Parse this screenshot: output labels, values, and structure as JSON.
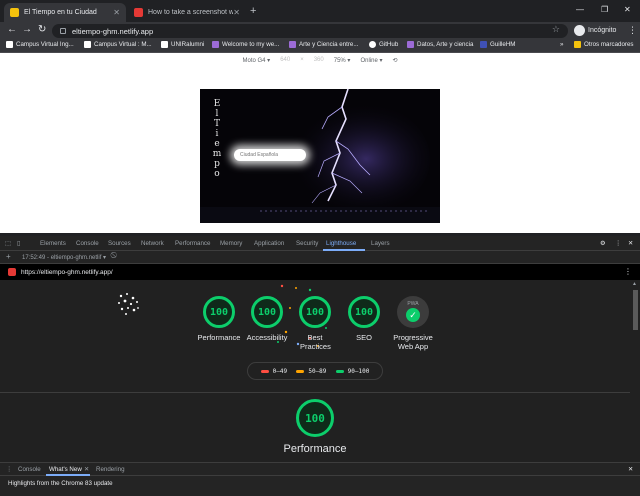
{
  "tabs": [
    {
      "title": "El Tiempo en tu Ciudad",
      "favicon_color": "#f4c20d",
      "active": true
    },
    {
      "title": "How to take a screenshot with h",
      "favicon_color": "#e53935",
      "active": false
    }
  ],
  "toolbar": {
    "url": "eltiempo-ghm.netlify.app",
    "incognito_label": "Incógnito"
  },
  "bookmarks": [
    {
      "label": "Campus Virtual Ing...",
      "icon_color": "#ffffff"
    },
    {
      "label": "Campus Virtual : M...",
      "icon_color": "#ffffff"
    },
    {
      "label": "UNIRalumni",
      "icon_color": "#ffffff"
    },
    {
      "label": "Welcome to my we...",
      "icon_color": "#9c6bd6"
    },
    {
      "label": "Arte y Ciencia entre...",
      "icon_color": "#9c6bd6"
    },
    {
      "label": "GitHub",
      "icon_color": "#ffffff"
    },
    {
      "label": "Datos, Arte y ciencia",
      "icon_color": "#9c6bd6"
    },
    {
      "label": "GuilleHM",
      "icon_color": "#3f51b5"
    },
    {
      "label": "»",
      "icon_color": ""
    },
    {
      "label": "Otros marcadores",
      "icon_color": "#f4c20d"
    }
  ],
  "device_toolbar": {
    "device": "Moto G4",
    "width": "640",
    "x": "×",
    "height": "360",
    "zoom": "75%",
    "throttle": "Online"
  },
  "site": {
    "title_letters": [
      "E",
      "l",
      " ",
      "T",
      "i",
      "e",
      "m",
      "p",
      "o"
    ],
    "input_placeholder": "Ciudad Española"
  },
  "devtools": {
    "tabs": [
      "Elements",
      "Console",
      "Sources",
      "Network",
      "Performance",
      "Memory",
      "Application",
      "Security",
      "Lighthouse",
      "Layers"
    ],
    "active_tab": "Lighthouse",
    "sub_report": "17:52:49 - eltiempo-ghm.netlif"
  },
  "lighthouse": {
    "report_url": "https://eltiempo-ghm.netlify.app/",
    "scores": [
      {
        "value": "100",
        "label": "Performance"
      },
      {
        "value": "100",
        "label": "Accessibility"
      },
      {
        "value": "100",
        "label": "Best Practices"
      },
      {
        "value": "100",
        "label": "SEO"
      }
    ],
    "pwa": {
      "badge": "PWA",
      "label": "Progressive Web App"
    },
    "legend": [
      {
        "range": "0–49",
        "color": "#ff4e42"
      },
      {
        "range": "50–89",
        "color": "#ffa400"
      },
      {
        "range": "90–100",
        "color": "#0cce6b"
      }
    ],
    "section_score": "100",
    "section_title": "Performance"
  },
  "drawer": {
    "tabs": [
      "Console",
      "What's New",
      "Rendering"
    ],
    "active_tab": "What's New",
    "body": "Highlights from the Chrome 83 update"
  }
}
